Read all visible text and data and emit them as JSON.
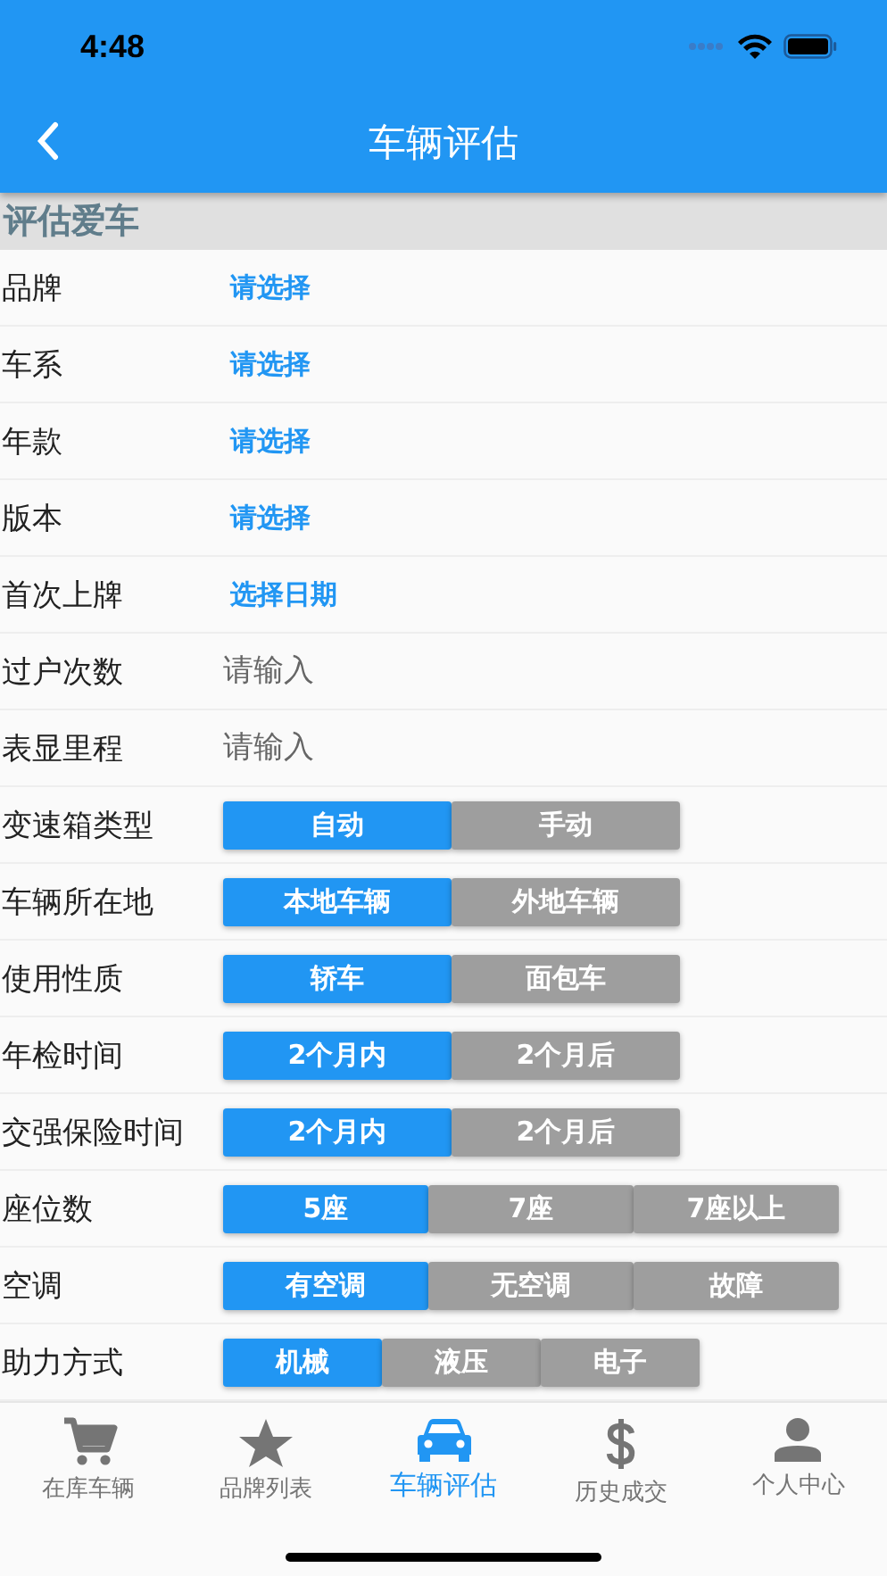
{
  "status_bar": {
    "time": "4:48"
  },
  "app_bar": {
    "title": "车辆评估"
  },
  "section": {
    "title": "评估爱车"
  },
  "rows": [
    {
      "label": "品牌",
      "kind": "select",
      "value": "请选择"
    },
    {
      "label": "车系",
      "kind": "select",
      "value": "请选择"
    },
    {
      "label": "年款",
      "kind": "select",
      "value": "请选择"
    },
    {
      "label": "版本",
      "kind": "select",
      "value": "请选择"
    },
    {
      "label": "首次上牌",
      "kind": "select",
      "value": "选择日期"
    },
    {
      "label": "过户次数",
      "kind": "input",
      "placeholder": "请输入"
    },
    {
      "label": "表显里程",
      "kind": "input",
      "placeholder": "请输入"
    },
    {
      "label": "变速箱类型",
      "kind": "segment",
      "options": [
        {
          "label": "自动",
          "selected": true
        },
        {
          "label": "手动",
          "selected": false
        }
      ]
    },
    {
      "label": "车辆所在地",
      "kind": "segment",
      "options": [
        {
          "label": "本地车辆",
          "selected": true
        },
        {
          "label": "外地车辆",
          "selected": false
        }
      ]
    },
    {
      "label": "使用性质",
      "kind": "segment",
      "options": [
        {
          "label": "轿车",
          "selected": true
        },
        {
          "label": "面包车",
          "selected": false
        }
      ]
    },
    {
      "label": "年检时间",
      "kind": "segment",
      "options": [
        {
          "label": "2个月内",
          "selected": true
        },
        {
          "label": "2个月后",
          "selected": false
        }
      ]
    },
    {
      "label": "交强保险时间",
      "kind": "segment",
      "options": [
        {
          "label": "2个月内",
          "selected": true
        },
        {
          "label": "2个月后",
          "selected": false
        }
      ]
    },
    {
      "label": "座位数",
      "kind": "segment",
      "options": [
        {
          "label": "5座",
          "selected": true
        },
        {
          "label": "7座",
          "selected": false
        },
        {
          "label": "7座以上",
          "selected": false
        }
      ]
    },
    {
      "label": "空调",
      "kind": "segment",
      "options": [
        {
          "label": "有空调",
          "selected": true
        },
        {
          "label": "无空调",
          "selected": false
        },
        {
          "label": "故障",
          "selected": false
        }
      ]
    },
    {
      "label": "助力方式",
      "kind": "segment",
      "options": [
        {
          "label": "机械",
          "selected": true
        },
        {
          "label": "液压",
          "selected": false
        },
        {
          "label": "电子",
          "selected": false
        }
      ]
    }
  ],
  "tab_bar": [
    {
      "label": "在库车辆",
      "selected": false
    },
    {
      "label": "品牌列表",
      "selected": false
    },
    {
      "label": "车辆评估",
      "selected": true
    },
    {
      "label": "历史成交",
      "selected": false
    },
    {
      "label": "个人中心",
      "selected": false
    }
  ]
}
